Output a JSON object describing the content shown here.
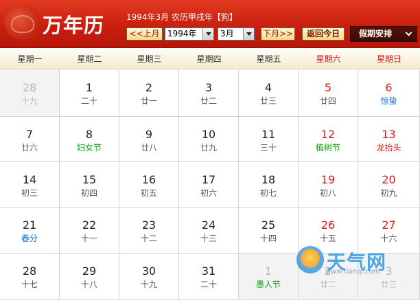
{
  "header": {
    "title": "万年历",
    "info_year_month": "1994年3月",
    "info_lunar": "农历甲戌年",
    "info_zodiac": "【狗】",
    "prev_label": "<<上月",
    "next_label": "下月>>",
    "today_label": "返回今日",
    "year_select": "1994年",
    "month_select": "3月",
    "holiday_label": "假期安排"
  },
  "colors": {
    "header_red": "#c81f0f",
    "weekend_red": "#e0191e",
    "solar_term_blue": "#1a6fd0",
    "festival_green": "#16a016"
  },
  "weekdays": [
    "星期一",
    "星期二",
    "星期三",
    "星期四",
    "星期五",
    "星期六",
    "星期日"
  ],
  "weeks": [
    [
      {
        "solar": "28",
        "lunar": "十九",
        "other": true
      },
      {
        "solar": "1",
        "lunar": "二十"
      },
      {
        "solar": "2",
        "lunar": "廿一"
      },
      {
        "solar": "3",
        "lunar": "廿二"
      },
      {
        "solar": "4",
        "lunar": "廿三"
      },
      {
        "solar": "5",
        "lunar": "廿四"
      },
      {
        "solar": "6",
        "lunar": "惊蛰",
        "kind": "term"
      }
    ],
    [
      {
        "solar": "7",
        "lunar": "廿六"
      },
      {
        "solar": "8",
        "lunar": "妇女节",
        "kind": "fest"
      },
      {
        "solar": "9",
        "lunar": "廿八"
      },
      {
        "solar": "10",
        "lunar": "廿九"
      },
      {
        "solar": "11",
        "lunar": "三十"
      },
      {
        "solar": "12",
        "lunar": "植树节",
        "kind": "fest"
      },
      {
        "solar": "13",
        "lunar": "龙抬头",
        "kind": "fest-red"
      }
    ],
    [
      {
        "solar": "14",
        "lunar": "初三"
      },
      {
        "solar": "15",
        "lunar": "初四"
      },
      {
        "solar": "16",
        "lunar": "初五"
      },
      {
        "solar": "17",
        "lunar": "初六"
      },
      {
        "solar": "18",
        "lunar": "初七"
      },
      {
        "solar": "19",
        "lunar": "初八"
      },
      {
        "solar": "20",
        "lunar": "初九"
      }
    ],
    [
      {
        "solar": "21",
        "lunar": "春分",
        "kind": "term"
      },
      {
        "solar": "22",
        "lunar": "十一"
      },
      {
        "solar": "23",
        "lunar": "十二"
      },
      {
        "solar": "24",
        "lunar": "十三"
      },
      {
        "solar": "25",
        "lunar": "十四"
      },
      {
        "solar": "26",
        "lunar": "十五"
      },
      {
        "solar": "27",
        "lunar": "十六"
      }
    ],
    [
      {
        "solar": "28",
        "lunar": "十七"
      },
      {
        "solar": "29",
        "lunar": "十八"
      },
      {
        "solar": "30",
        "lunar": "十九"
      },
      {
        "solar": "31",
        "lunar": "二十"
      },
      {
        "solar": "1",
        "lunar": "愚人节",
        "kind": "fest",
        "other": true
      },
      {
        "solar": "2",
        "lunar": "廿二",
        "other": true
      },
      {
        "solar": "3",
        "lunar": "廿三",
        "other": true
      }
    ]
  ],
  "watermark": {
    "text": "天气网",
    "url": "www.tianqi.com"
  }
}
